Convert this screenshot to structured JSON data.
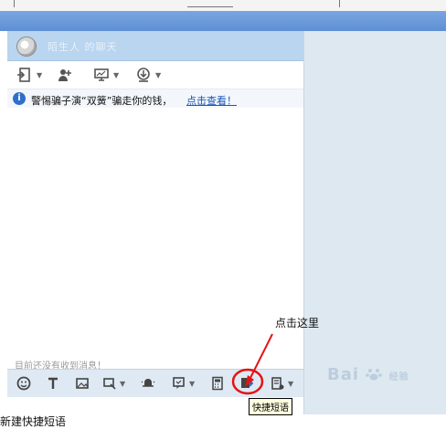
{
  "chat_window": {
    "contact_name": "陌生人 的聊天",
    "notice": {
      "text": "警惕骗子演“双簧”骗走你的钱，",
      "link": "点击查看！"
    },
    "empty_message": "目前还没有收到消息！",
    "tooltip": "快捷短语"
  },
  "annotation": {
    "text": "点击这里"
  },
  "watermark": {
    "text": "Bai",
    "suffix": "经验"
  },
  "caption": "新建快捷短语",
  "colors": {
    "title_bar": "#6b9bdb",
    "header": "#b9d5ef",
    "bottom_toolbar": "#dfe9f3",
    "annotation_red": "#e31414"
  }
}
